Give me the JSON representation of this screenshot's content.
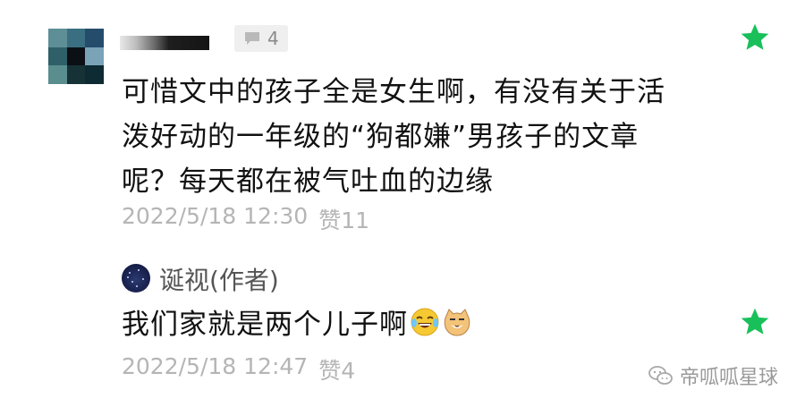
{
  "comment": {
    "reply_count": "4",
    "lines": [
      "可惜文中的孩子全是女生啊，有没有关于活",
      "泼好动的一年级的“狗都嫌”男孩子的文章",
      "呢？每天都在被气吐血的边缘"
    ],
    "timestamp": "2022/5/18 12:30",
    "likes": "赞11",
    "featured_color": "#19c05a"
  },
  "author_reply": {
    "author": "诞视(作者)",
    "text": "我们家就是两个儿子啊",
    "emojis": [
      "laughing-tears-emoji",
      "smirking-cat-emoji"
    ],
    "timestamp": "2022/5/18 12:47",
    "likes": "赞4",
    "featured_color": "#19c05a"
  },
  "watermark": {
    "text": "帝呱呱星球"
  }
}
